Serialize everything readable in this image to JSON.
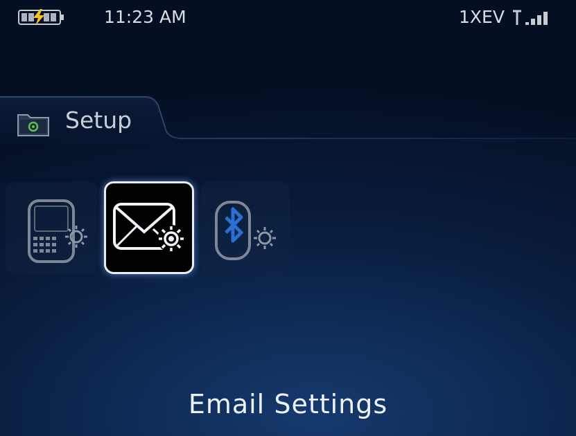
{
  "status_bar": {
    "time": "11:23 AM",
    "network": "1XEV",
    "battery_icon": "charging-battery-icon",
    "signal_icon": "signal-strength-icon"
  },
  "folder": {
    "label": "Setup",
    "icon": "folder-gear-icon"
  },
  "apps": [
    {
      "name": "device-settings-icon",
      "selected": false
    },
    {
      "name": "email-settings-icon",
      "selected": true
    },
    {
      "name": "bluetooth-settings-icon",
      "selected": false
    }
  ],
  "selected_app_label": "Email Settings",
  "colors": {
    "background": "#081a38",
    "accent": "#2a6fd6",
    "selection_border": "#e8eef7"
  }
}
